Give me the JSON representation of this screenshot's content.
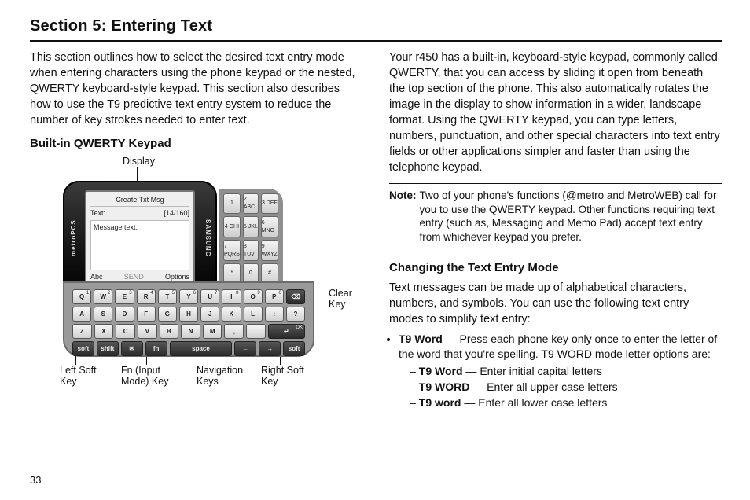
{
  "page_number": "33",
  "title": "Section 5: Entering Text",
  "left": {
    "intro": "This section outlines how to select the desired text entry mode when entering characters using the phone keypad or the nested, QWERTY keyboard-style keypad. This section also describes how to use the T9 predictive text entry system to reduce the number of key strokes needed to enter text.",
    "subhead": "Built-in QWERTY Keypad"
  },
  "right": {
    "para": "Your r450 has a built-in, keyboard-style keypad, commonly called QWERTY, that you can access by sliding it open from beneath the top section of the phone. This also automatically rotates the image in the display to show information in a wider, landscape format. Using the QWERTY keypad, you can type letters, numbers, punctuation, and other special characters into text entry fields or other applications simpler and faster than using the telephone keypad.",
    "note_label": "Note:",
    "note": "Two of your phone's functions (@metro and MetroWEB) call for you to use the QWERTY keypad. Other functions requiring text entry (such as, Messaging and Memo Pad) accept text entry from whichever keypad you prefer.",
    "subhead": "Changing the Text Entry Mode",
    "para2": "Text messages can be made up of alphabetical characters, numbers, and symbols. You can use the following text entry modes to simplify text entry:",
    "bullet_label": "T9 Word",
    "bullet_text": " — Press each phone key only once to enter the letter of the word that you're spelling. T9 WORD mode letter options are:",
    "opts": [
      {
        "name": "T9 Word",
        "desc": " — Enter initial capital letters"
      },
      {
        "name": "T9 WORD",
        "desc": " — Enter all upper case letters"
      },
      {
        "name": "T9 word",
        "desc": " — Enter all lower case letters"
      }
    ]
  },
  "fig": {
    "callouts": {
      "display": "Display",
      "clear": "Clear Key",
      "leftsoft": "Left Soft Key",
      "fn": "Fn (Input Mode) Key",
      "nav": "Navigation Keys",
      "rightsoft": "Right Soft Key"
    },
    "screen": {
      "title": "Create Txt Msg",
      "textlabel": "Text:",
      "count": "[14/160]",
      "body": "Message text.",
      "bl": "Abc",
      "bc": "SEND",
      "br": "Options"
    },
    "brand_left": "metroPCS",
    "brand_right": "SAMSUNG",
    "numpad": [
      "1",
      "2 ABC",
      "3 DEF",
      "4 GHI",
      "5 JKL",
      "6 MNO",
      "7 PQRS",
      "8 TUV",
      "9 WXYZ",
      "*",
      "0",
      "#"
    ],
    "rows": {
      "r1": [
        [
          "Q",
          "1"
        ],
        [
          "W",
          "2"
        ],
        [
          "E",
          "3"
        ],
        [
          "R",
          "4"
        ],
        [
          "T",
          "5"
        ],
        [
          "Y",
          "6"
        ],
        [
          "U",
          "7"
        ],
        [
          "I",
          "8"
        ],
        [
          "O",
          "9"
        ],
        [
          "P",
          "0"
        ],
        [
          "⌫",
          ""
        ]
      ],
      "r2": [
        [
          "A",
          ""
        ],
        [
          "S",
          ""
        ],
        [
          "D",
          ""
        ],
        [
          "F",
          ""
        ],
        [
          "G",
          ""
        ],
        [
          "H",
          ""
        ],
        [
          "J",
          ""
        ],
        [
          "K",
          ""
        ],
        [
          "L",
          ""
        ],
        [
          ":",
          ""
        ],
        [
          "?",
          ""
        ]
      ],
      "r3": [
        [
          "Z",
          ""
        ],
        [
          "X",
          ""
        ],
        [
          "C",
          ""
        ],
        [
          "V",
          ""
        ],
        [
          "B",
          ""
        ],
        [
          "N",
          ""
        ],
        [
          "M",
          ""
        ],
        [
          ",",
          ""
        ],
        [
          ".",
          ""
        ],
        [
          "↵",
          "OK"
        ]
      ],
      "r4": [
        [
          "soft",
          ""
        ],
        [
          "shift",
          ""
        ],
        [
          "✉",
          ""
        ],
        [
          "fn",
          ""
        ],
        [
          "space",
          ""
        ],
        [
          "←",
          ""
        ],
        [
          "→",
          ""
        ],
        [
          "soft",
          ""
        ]
      ]
    }
  }
}
